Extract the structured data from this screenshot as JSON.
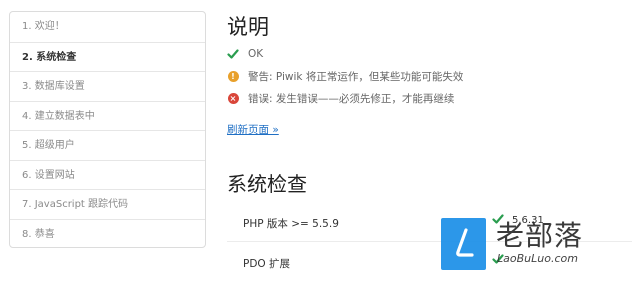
{
  "sidebar": {
    "steps": [
      {
        "label": "1. 欢迎！"
      },
      {
        "label": "2. 系统检查"
      },
      {
        "label": "3. 数据库设置"
      },
      {
        "label": "4. 建立数据表中"
      },
      {
        "label": "5. 超级用户"
      },
      {
        "label": "6. 设置网站"
      },
      {
        "label": "7. JavaScript 跟踪代码"
      },
      {
        "label": "8. 恭喜"
      }
    ],
    "active_index": 1
  },
  "main": {
    "title": "说明",
    "legend": [
      {
        "icon": "checkmark-icon",
        "text": "OK"
      },
      {
        "icon": "warning-icon",
        "text": "警告: Piwik 将正常运作，但某些功能可能失效"
      },
      {
        "icon": "error-icon",
        "text": "错误: 发生错误——必须先修正，才能再继续"
      }
    ],
    "refresh_link": "刷新页面 »",
    "section_title": "系统检查",
    "checks": [
      {
        "name": "PHP 版本 >= 5.5.9",
        "status": "ok",
        "value": "5.6.31"
      },
      {
        "name": "PDO 扩展",
        "status": "ok",
        "value": ""
      }
    ]
  },
  "watermark": {
    "title": "老部落",
    "subtitle": "LaoBuLuo.com"
  },
  "colors": {
    "ok": "#2a9d4f",
    "warning": "#e8a02b",
    "error": "#d9463a",
    "link": "#1f6fc4",
    "watermark_logo": "#1b8fe8"
  }
}
